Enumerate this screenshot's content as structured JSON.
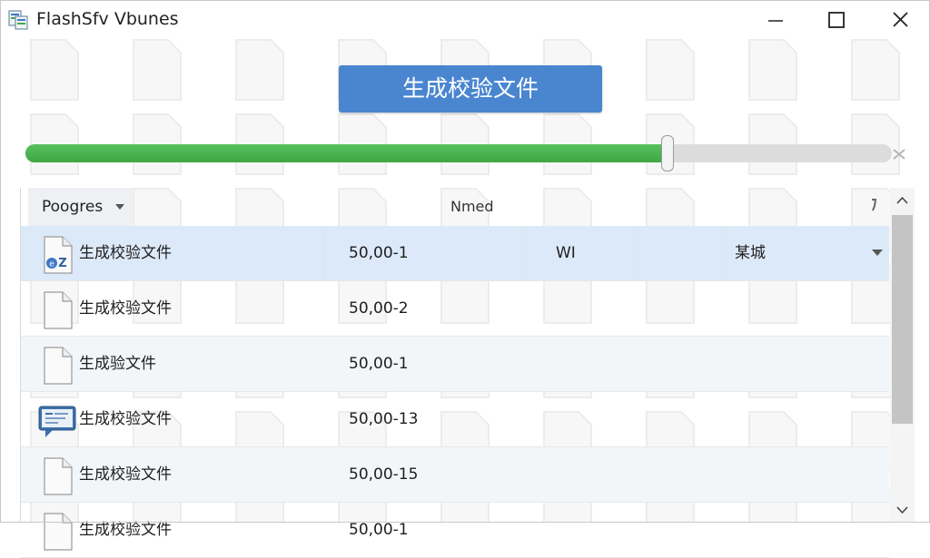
{
  "window": {
    "title": "FlashSfv Vbunes",
    "app_icon": "flashsfv-app-icon",
    "controls": [
      "minimize-icon",
      "maximize-icon",
      "close-icon"
    ]
  },
  "toolbar": {
    "generate_label": "生成校验文件"
  },
  "progress": {
    "fraction": 0.74
  },
  "list": {
    "sort_column_label": "Poogres",
    "name_column_label": "Nmed",
    "rows": [
      {
        "icon": "zip-file-icon",
        "name": "生成校验文件",
        "size": "50,00-1",
        "type": "WI",
        "status": "某城",
        "selected": true,
        "has_dropdown": true
      },
      {
        "icon": "blank-file-icon",
        "name": "生成校验文件",
        "size": "50,00-2",
        "type": "",
        "status": "",
        "selected": false,
        "has_dropdown": false
      },
      {
        "icon": "blank-file-icon",
        "name": "生成验文件",
        "size": "50,00-1",
        "type": "",
        "status": "",
        "selected": false,
        "has_dropdown": false
      },
      {
        "icon": "chat-file-icon",
        "name": "生成校验文件",
        "size": "50,00-13",
        "type": "",
        "status": "",
        "selected": false,
        "has_dropdown": false
      },
      {
        "icon": "blank-file-icon",
        "name": "生成校验文件",
        "size": "50,00-15",
        "type": "",
        "status": "",
        "selected": false,
        "has_dropdown": false
      },
      {
        "icon": "blank-file-icon",
        "name": "生成校验文件",
        "size": "50,00-1",
        "type": "",
        "status": "",
        "selected": false,
        "has_dropdown": false
      }
    ]
  },
  "colors": {
    "accent_button": "#4a86d0",
    "progress_fill": "#4caf50",
    "selected_row": "#dce9f8"
  }
}
